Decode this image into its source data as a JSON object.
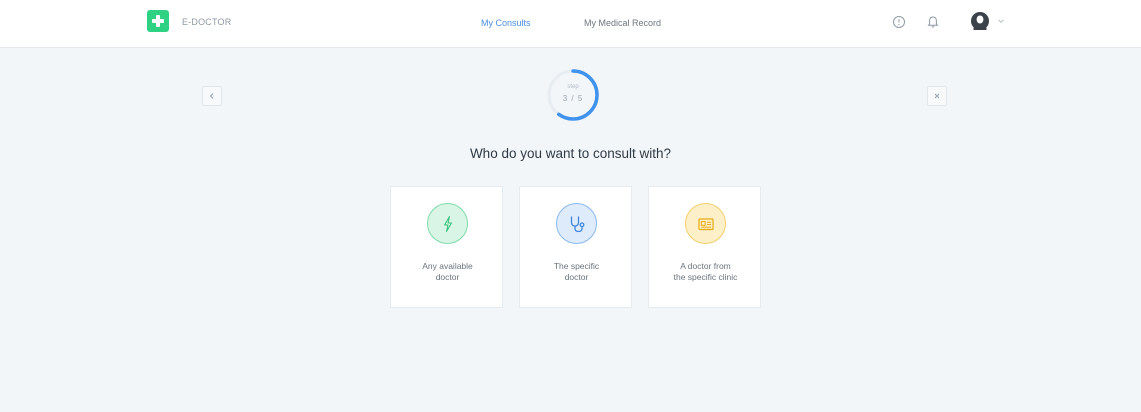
{
  "app": {
    "logo_text": "E-DOCTOR",
    "brand_color": "#2fd183",
    "accent_color": "#4a90e2"
  },
  "nav": {
    "items": [
      {
        "label": "My Consults",
        "active": true
      },
      {
        "label": "My Medical Record",
        "active": false
      }
    ]
  },
  "header_icons": [
    "help-icon",
    "bell-icon",
    "avatar",
    "chevron-down-icon"
  ],
  "wizard": {
    "step_label": "step",
    "step_value": "3 / 5",
    "progress_fraction": 0.6,
    "back_icon": "chevron-left-icon",
    "close_icon": "close-icon"
  },
  "question": "Who do you want to consult with?",
  "options": [
    {
      "label": "Any available\ndoctor",
      "icon": "lightning-icon",
      "color": "#2fd183"
    },
    {
      "label": "The specific\ndoctor",
      "icon": "stethoscope-icon",
      "color": "#4a90e2"
    },
    {
      "label": "A doctor from\nthe specific clinic",
      "icon": "clinic-card-icon",
      "color": "#f5b82e"
    }
  ]
}
